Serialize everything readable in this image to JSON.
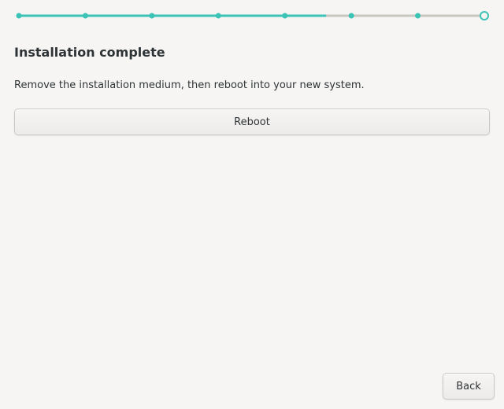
{
  "progress": {
    "total_steps": 8,
    "current_step": 8,
    "filled_fraction": 0.66,
    "colors": {
      "done": "#3bc3b5",
      "pending": "#c9c6c2",
      "current_ring": "#3bc3b5"
    }
  },
  "page": {
    "title": "Installation complete",
    "message": "Remove the installation medium, then reboot into your new system."
  },
  "actions": {
    "reboot_label": "Reboot",
    "back_label": "Back"
  }
}
